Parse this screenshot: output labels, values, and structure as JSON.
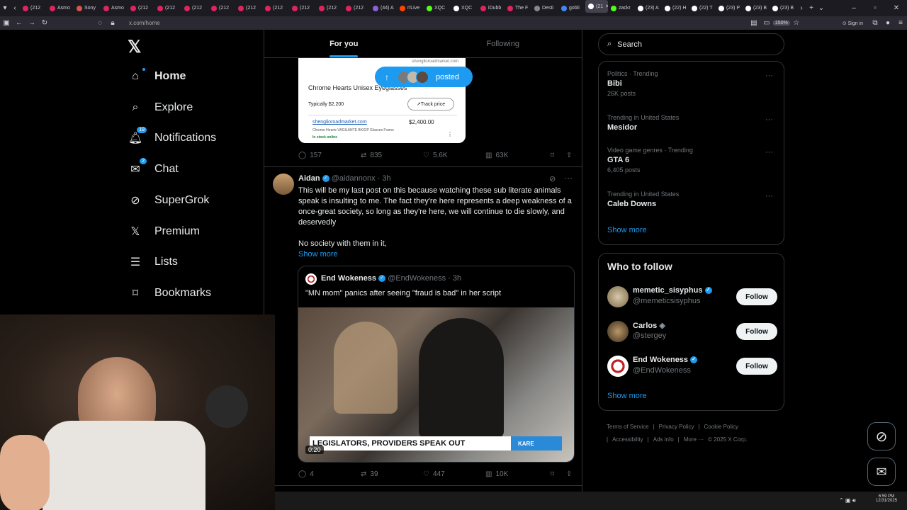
{
  "browser": {
    "tabs": [
      "(212",
      "Asmo",
      "Sony",
      "Asmo",
      "(212",
      "(212",
      "(212",
      "(212",
      "(212",
      "(212",
      "(212",
      "(212",
      "(212",
      "(44) A",
      "r/Live",
      "XQC",
      "XQC",
      "iDubb",
      "The F",
      "Desti",
      "gobli",
      "(21",
      "zackr",
      "(23) A",
      "(22) H",
      "(22) T",
      "(23) P",
      "(23) B",
      "(23) B"
    ],
    "tab_colors": [
      "#e0245e",
      "#e0245e",
      "#d9534f",
      "#e0245e",
      "#e0245e",
      "#e0245e",
      "#e0245e",
      "#e0245e",
      "#e0245e",
      "#e0245e",
      "#e0245e",
      "#e0245e",
      "#e0245e",
      "#8a63d2",
      "#ff4500",
      "#53fc18",
      "#ffffff",
      "#e0245e",
      "#e0245e",
      "#888888",
      "#4285f4",
      "#ffffff",
      "#53fc18",
      "#ffffff",
      "#ffffff",
      "#ffffff",
      "#ffffff",
      "#ffffff",
      "#ffffff"
    ],
    "active_tab_index": 21,
    "url": "x.com/home",
    "zoom": "150%",
    "sign_in": "Sign in"
  },
  "nav": {
    "items": [
      {
        "label": "Home",
        "icon": "home-icon",
        "badge": ""
      },
      {
        "label": "Explore",
        "icon": "search-icon",
        "badge": ""
      },
      {
        "label": "Notifications",
        "icon": "bell-icon",
        "badge": "19"
      },
      {
        "label": "Chat",
        "icon": "mail-icon",
        "badge": "2"
      },
      {
        "label": "SuperGrok",
        "icon": "grok-icon",
        "badge": ""
      },
      {
        "label": "Premium",
        "icon": "x-logo-icon",
        "badge": ""
      },
      {
        "label": "Lists",
        "icon": "list-icon",
        "badge": ""
      },
      {
        "label": "Bookmarks",
        "icon": "bookmark-icon",
        "badge": ""
      }
    ]
  },
  "feed": {
    "tabs": [
      "For you",
      "Following"
    ],
    "posted_pill": "posted",
    "shop_card": {
      "site_top": "shenglioroadmarket.com",
      "title": "Chrome Hearts Unisex Eyeglasses",
      "typical": "Typically $2,200",
      "track": "Track price",
      "site": "shenglioroadmarket.com",
      "price": "$2,400.00",
      "desc": "Chrome Hearts VAGILANTE BK/GP Glasses Frame",
      "stock": "In stock online"
    },
    "post1_stats": {
      "replies": "157",
      "reposts": "835",
      "likes": "5.6K",
      "views": "63K"
    },
    "tweet": {
      "name": "Aidan",
      "handle": "@aidannonx",
      "time": "· 3h",
      "text": "This will be my last post on this because watching these sub literate animals speak is insulting to me. The fact they're here represents a deep weakness of a once-great society, so long as they're here, we will continue to die slowly, and deservedly",
      "text2": "No society with them in it,",
      "show_more": "Show more",
      "quote": {
        "name": "End Wokeness",
        "handle": "@EndWokeness",
        "time": "· 3h",
        "text": "\"MN mom\" panics after seeing \"fraud is bad\" in her script",
        "chyron": "LEGISLATORS, PROVIDERS SPEAK OUT",
        "station": "KARE",
        "duration": "0:20"
      },
      "stats": {
        "replies": "4",
        "reposts": "39",
        "likes": "447",
        "views": "10K"
      }
    }
  },
  "right": {
    "search_placeholder": "Search",
    "trends": [
      {
        "meta": "Politics · Trending",
        "name": "Bibi",
        "count": "26K posts"
      },
      {
        "meta": "Trending in United States",
        "name": "Mesidor",
        "count": ""
      },
      {
        "meta": "Video game genres · Trending",
        "name": "GTA 6",
        "count": "6,405 posts"
      },
      {
        "meta": "Trending in United States",
        "name": "Caleb Downs",
        "count": ""
      }
    ],
    "show_more": "Show more",
    "who_to_follow": {
      "title": "Who to follow",
      "accounts": [
        {
          "name": "memetic_sisyphus",
          "handle": "@memeticsisyphus",
          "verified": true
        },
        {
          "name": "Carlos",
          "handle": "@stergey",
          "verified": false
        },
        {
          "name": "End Wokeness",
          "handle": "@EndWokeness",
          "verified": true
        }
      ],
      "follow_label": "Follow",
      "show_more": "Show more"
    },
    "footer": [
      "Terms of Service",
      "|",
      "Privacy Policy",
      "|",
      "Cookie Policy",
      "|",
      "Accessibility",
      "|",
      "Ads info",
      "|",
      "More ···",
      "© 2025 X Corp."
    ]
  },
  "taskbar": {
    "time": "6:59 PM",
    "date": "12/31/2025"
  },
  "colors": {
    "accent": "#1d9bf0",
    "border": "#2f3336",
    "muted": "#71767b"
  }
}
